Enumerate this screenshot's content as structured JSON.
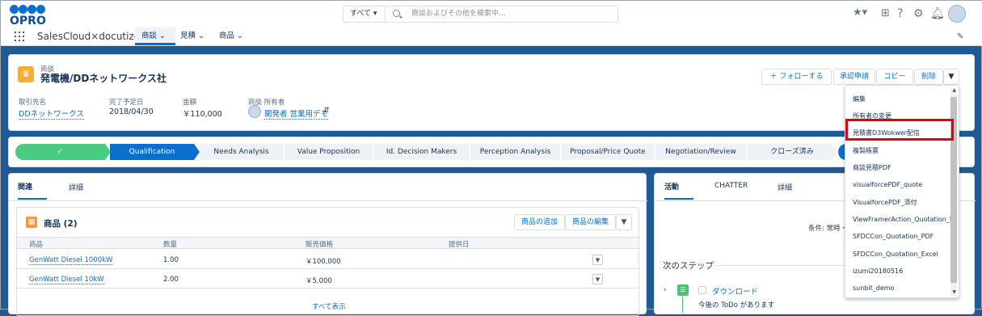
{
  "brand": {
    "logo_text": "OPRO",
    "app_name": "SalesCloud×docutize"
  },
  "search": {
    "scope": "すべて",
    "placeholder": "商談およびその他を検索中..."
  },
  "nav": {
    "tabs": [
      {
        "label": "商談"
      },
      {
        "label": "見積"
      },
      {
        "label": "商品"
      }
    ]
  },
  "record": {
    "type_label": "商談",
    "title": "発電機/DDネットワークス社",
    "buttons": {
      "follow": "フォローする",
      "approve": "承認申請",
      "copy": "コピー",
      "delete": "削除"
    },
    "fields": [
      {
        "label": "取引先名",
        "value": "DDネットワークス"
      },
      {
        "label": "完了予定日",
        "value": "2018/04/30"
      },
      {
        "label": "金額",
        "value": "￥110,000"
      },
      {
        "label": "商談 所有者",
        "value": "開発者 営業用デモ"
      }
    ]
  },
  "path": {
    "steps": [
      "✓",
      "Qualification",
      "Needs Analysis",
      "Value Proposition",
      "Id. Decision Makers",
      "Perception Analysis",
      "Proposal/Price Quote",
      "Negotiation/Review",
      "クローズ済み"
    ]
  },
  "left_tabs": [
    "関連",
    "詳細"
  ],
  "products": {
    "title": "商品 (2)",
    "add_button": "商品の追加",
    "edit_button": "商品の編集",
    "columns": [
      "商品",
      "数量",
      "販売価格",
      "提供日"
    ],
    "rows": [
      {
        "name": "GenWatt Diesel 1000kW",
        "qty": "1.00",
        "price": "￥100,000",
        "date": ""
      },
      {
        "name": "GenWatt Diesel 10kW",
        "qty": "2.00",
        "price": "￥5,000",
        "date": ""
      }
    ],
    "view_all": "すべて表示"
  },
  "right_tabs": [
    "活動",
    "CHATTER",
    "詳細"
  ],
  "activity": {
    "filter_text": "条件: 常時・",
    "next_steps": "次のステップ",
    "todo_title": "ダウンロード",
    "todo_sub": "今後の ToDo があります"
  },
  "dropdown": {
    "items": [
      "編集",
      "所有者の変更",
      "見積書D3Wokwer配信",
      "複製帳票",
      "商談見積PDF",
      "visualforcePDF_quote",
      "VisualforcePDF_添付",
      "ViewFramerAction_Quotation_PDF",
      "SFDCCon_Quotation_PDF",
      "SFDCCon_Quotation_Excel",
      "izumi20180516",
      "sunbit_demo"
    ]
  },
  "colors": {
    "accent": "#0070d2",
    "path_active": "#0b6fcd",
    "path_done": "#4bca81",
    "highlight": "#e3000f"
  }
}
